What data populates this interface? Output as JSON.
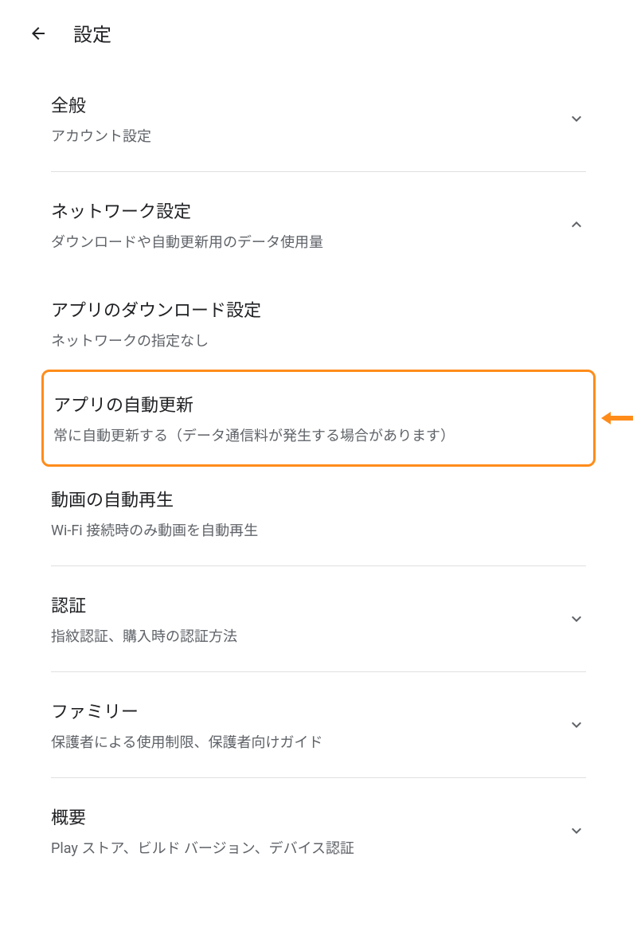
{
  "header": {
    "title": "設定"
  },
  "sections": {
    "general": {
      "title": "全般",
      "subtitle": "アカウント設定"
    },
    "network": {
      "title": "ネットワーク設定",
      "subtitle": "ダウンロードや自動更新用のデータ使用量",
      "items": {
        "download": {
          "title": "アプリのダウンロード設定",
          "subtitle": "ネットワークの指定なし"
        },
        "auto_update": {
          "title": "アプリの自動更新",
          "subtitle": "常に自動更新する（データ通信料が発生する場合があります）"
        },
        "video_autoplay": {
          "title": "動画の自動再生",
          "subtitle": "Wi-Fi 接続時のみ動画を自動再生"
        }
      }
    },
    "auth": {
      "title": "認証",
      "subtitle": "指紋認証、購入時の認証方法"
    },
    "family": {
      "title": "ファミリー",
      "subtitle": "保護者による使用制限、保護者向けガイド"
    },
    "about": {
      "title": "概要",
      "subtitle": "Play ストア、ビルド バージョン、デバイス認証"
    }
  }
}
